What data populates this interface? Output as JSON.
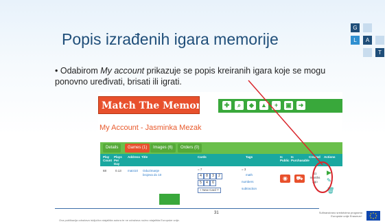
{
  "slide": {
    "title": "Popis izrađenih igara memorije",
    "bullet_pre": "Odabirom ",
    "bullet_em": "My account",
    "bullet_post": " prikazuje se popis kreiranih igara koje se mogu ponovno uređivati, brisati ili igrati.",
    "page_number": "31",
    "disclaimer": "Ova publikacija odražava isključivo stajališta autora te ne odražava nužno stajališta Europske unije.",
    "eu_text": "Sufinancirano sredstvima programa Europske unije Erasmus+",
    "logo_letters": [
      "G",
      "L",
      "A",
      "T"
    ],
    "colors": {
      "title": "#1f4e79",
      "annotation": "#d9262c",
      "accent": "#3b6ea8"
    }
  },
  "app": {
    "brand": "Match The Memory",
    "nav_icons": [
      "puzzle-icon",
      "search-icon",
      "tag-icon",
      "thumbs-up-icon",
      "plus-icon",
      "cart-icon",
      "logout-icon"
    ],
    "account_title": "My Account - Jasminka Mezak",
    "tabs": [
      {
        "label": "Details",
        "active": false
      },
      {
        "label": "Games (1)",
        "active": true
      },
      {
        "label": "Images (6)",
        "active": false
      },
      {
        "label": "Orders (0)",
        "active": false
      }
    ],
    "columns": [
      "Play Count",
      "Plays Per Day",
      "Address",
      "Title",
      "Cards",
      "Tags",
      "Is Public",
      "Is Purchasable",
      "Created",
      "Actions"
    ],
    "row": {
      "play_count": "68",
      "plays_per_day": "0.13",
      "address": "mat410",
      "title": "Oduzimanje brojeva do 10",
      "cards_count": "= 7",
      "card_nums": [
        "4",
        "8",
        "3",
        "2",
        "5",
        "4",
        "6"
      ],
      "new_card": "+ New Card 7",
      "tag_count": "= 3",
      "tags": [
        "math",
        "numbers",
        "subtraction"
      ],
      "created": "11 months ago"
    }
  }
}
